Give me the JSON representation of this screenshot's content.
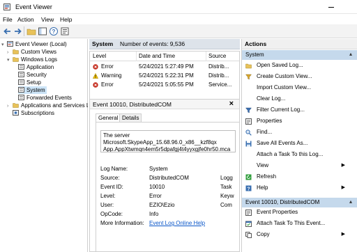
{
  "window": {
    "title": "Event Viewer"
  },
  "menu": [
    "File",
    "Action",
    "View",
    "Help"
  ],
  "tree": {
    "root": "Event Viewer (Local)",
    "custom_views": "Custom Views",
    "windows_logs": "Windows Logs",
    "logs": [
      "Application",
      "Security",
      "Setup",
      "System",
      "Forwarded Events"
    ],
    "apps_services": "Applications and Services Lo",
    "subscriptions": "Subscriptions"
  },
  "center": {
    "log_name": "System",
    "event_count": "Number of events: 9,536",
    "columns": [
      "Level",
      "Date and Time",
      "Source"
    ],
    "rows": [
      {
        "level": "Error",
        "datetime": "5/24/2021 5:27:49 PM",
        "source": "Distrib..."
      },
      {
        "level": "Warning",
        "datetime": "5/24/2021 5:22:31 PM",
        "source": "Distrib..."
      },
      {
        "level": "Error",
        "datetime": "5/24/2021 5:05:55 PM",
        "source": "Service..."
      }
    ]
  },
  "detail": {
    "title": "Event 10010, DistributedCOM",
    "close": "×",
    "tabs": [
      "General",
      "Details"
    ],
    "message": "The server Microsoft.SkypeApp_15.68.96.0_x86__kzf8qx\nApp.AppXtwmqn4em5r5dpafgj4t4yyxgjfe0hr50.mca d\nrequired timeout.",
    "props": [
      {
        "label": "Log Name:",
        "value": "System",
        "extra": ""
      },
      {
        "label": "Source:",
        "value": "DistributedCOM",
        "extra": "Logg"
      },
      {
        "label": "Event ID:",
        "value": "10010",
        "extra": "Task"
      },
      {
        "label": "Level:",
        "value": "Error",
        "extra": "Keyw"
      },
      {
        "label": "User:",
        "value": "EZIO\\Ezio",
        "extra": "Com"
      },
      {
        "label": "OpCode:",
        "value": "Info",
        "extra": ""
      },
      {
        "label": "More Information:",
        "value": "Event Log Online Help",
        "extra": ""
      }
    ]
  },
  "actions": {
    "title": "Actions",
    "section1": "System",
    "items1": [
      "Open Saved Log...",
      "Create Custom View...",
      "Import Custom View...",
      "Clear Log...",
      "Filter Current Log...",
      "Properties",
      "Find...",
      "Save All Events As...",
      "Attach a Task To this Log...",
      "View",
      "Refresh",
      "Help"
    ],
    "section2": "Event 10010, DistributedCOM",
    "items2": [
      "Event Properties",
      "Attach Task To This Event...",
      "Copy"
    ]
  },
  "colors": {
    "selection": "#cce4f7",
    "section": "#c5d9ec",
    "link": "#0b57c9",
    "error": "#c42b1c",
    "warning": "#f2c200"
  }
}
